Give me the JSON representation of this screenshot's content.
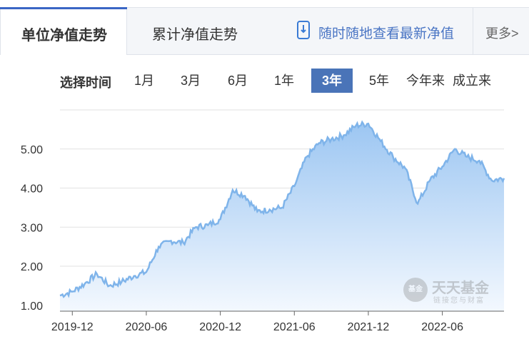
{
  "tabs": {
    "active": "单位净值走势",
    "second": "累计净值走势",
    "promo": "随时随地查看最新净值",
    "more": "更多>"
  },
  "range": {
    "label": "选择时间",
    "options": [
      "1月",
      "3月",
      "6月",
      "1年",
      "3年",
      "5年",
      "今年来",
      "成立来"
    ],
    "selected": "3年"
  },
  "watermark": {
    "logo": "基金",
    "title": "天天基金",
    "subtitle": "链接您与财富"
  },
  "colors": {
    "accent": "#3a66c5",
    "line": "#7fb4ea",
    "area_top": "#9cc6f2",
    "area_bottom": "#f3f8fe",
    "grid": "#e2e2e2"
  },
  "chart_data": {
    "type": "area",
    "title": "",
    "xlabel": "",
    "ylabel": "",
    "ylim": [
      0.85,
      6.0
    ],
    "yticks": [
      "1.00",
      "2.00",
      "3.00",
      "4.00",
      "5.00"
    ],
    "xticks": [
      "2019-12",
      "2020-06",
      "2020-12",
      "2021-06",
      "2021-12",
      "2022-06"
    ],
    "grid": true,
    "x": [
      "2019-11",
      "2019-12",
      "2020-01",
      "2020-02",
      "2020-03",
      "2020-04",
      "2020-05",
      "2020-06",
      "2020-07",
      "2020-08",
      "2020-09",
      "2020-10",
      "2020-11",
      "2020-12",
      "2021-01",
      "2021-02",
      "2021-03",
      "2021-04",
      "2021-05",
      "2021-06",
      "2021-07",
      "2021-08",
      "2021-09",
      "2021-10",
      "2021-11",
      "2021-12",
      "2022-01",
      "2022-02",
      "2022-03",
      "2022-04",
      "2022-05",
      "2022-06",
      "2022-07",
      "2022-08",
      "2022-09",
      "2022-10",
      "2022-11"
    ],
    "series": [
      {
        "values": [
          1.25,
          1.35,
          1.55,
          1.8,
          1.5,
          1.6,
          1.75,
          1.85,
          2.5,
          2.65,
          2.6,
          3.0,
          3.05,
          3.2,
          3.95,
          3.8,
          3.4,
          3.45,
          3.5,
          4.05,
          4.8,
          5.15,
          5.25,
          5.35,
          5.6,
          5.65,
          5.2,
          4.8,
          4.5,
          3.6,
          4.2,
          4.55,
          5.0,
          4.8,
          4.7,
          4.2,
          4.25
        ]
      }
    ]
  }
}
